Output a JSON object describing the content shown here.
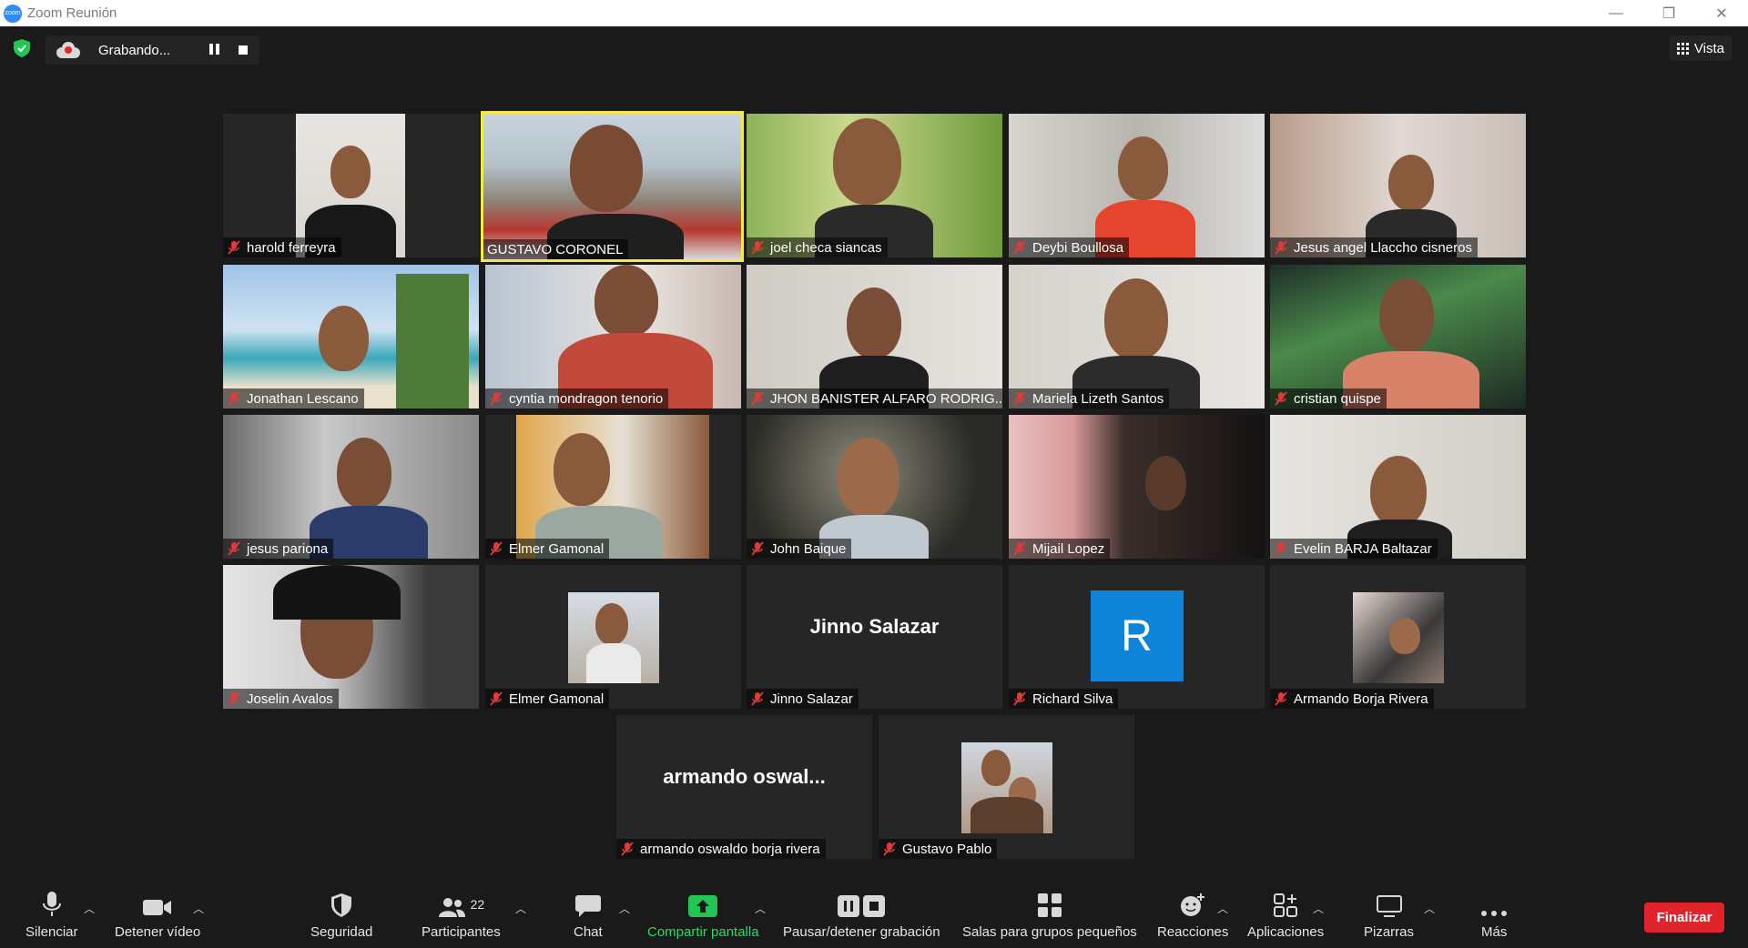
{
  "window": {
    "title": "Zoom Reunión",
    "minimize": "—",
    "restore": "❐",
    "close": "✕"
  },
  "recording": {
    "label": "Grabando..."
  },
  "view_button": {
    "label": "Vista"
  },
  "participants": [
    {
      "name": "harold ferreyra",
      "muted": true
    },
    {
      "name": "GUSTAVO CORONEL",
      "muted": false,
      "active_speaker": true
    },
    {
      "name": "joel checa siancas",
      "muted": true
    },
    {
      "name": "Deybi Boullosa",
      "muted": true
    },
    {
      "name": "Jesus angel Llaccho cisneros",
      "muted": true
    },
    {
      "name": "Jonathan Lescano",
      "muted": true
    },
    {
      "name": "cyntia mondragon tenorio",
      "muted": true
    },
    {
      "name": "JHON BANISTER ALFARO RODRIG...",
      "muted": true
    },
    {
      "name": "Mariela Lizeth Santos",
      "muted": true
    },
    {
      "name": "cristian quispe",
      "muted": true
    },
    {
      "name": "jesus pariona",
      "muted": true
    },
    {
      "name": "Elmer Gamonal",
      "muted": true
    },
    {
      "name": "John Baique",
      "muted": true
    },
    {
      "name": "Mijail Lopez",
      "muted": true
    },
    {
      "name": "Evelin BARJA  Baltazar",
      "muted": true
    },
    {
      "name": "Joselin Avalos",
      "muted": true
    },
    {
      "name": "Elmer Gamonal",
      "muted": true
    },
    {
      "name": "Jinno Salazar",
      "muted": true,
      "center_text": "Jinno Salazar"
    },
    {
      "name": "Richard Silva",
      "muted": true,
      "avatar_letter": "R"
    },
    {
      "name": "Armando Borja Rivera",
      "muted": true
    },
    {
      "name": "armando oswaldo borja rivera",
      "muted": true,
      "center_text": "armando  oswal..."
    },
    {
      "name": "Gustavo Pablo",
      "muted": true
    }
  ],
  "toolbar": {
    "mute": "Silenciar",
    "video": "Detener vídeo",
    "security": "Seguridad",
    "participants": "Participantes",
    "participants_count": "22",
    "chat": "Chat",
    "share": "Compartir pantalla",
    "pause_recording": "Pausar/detener grabación",
    "breakout": "Salas para grupos pequeños",
    "reactions": "Reacciones",
    "apps": "Aplicaciones",
    "whiteboards": "Pizarras",
    "more": "Más",
    "end": "Finalizar"
  },
  "colors": {
    "accent_green": "#2fd86b",
    "end_red": "#e0242b",
    "active_border": "#f3e94a",
    "avatar_blue": "#0e84d8"
  }
}
